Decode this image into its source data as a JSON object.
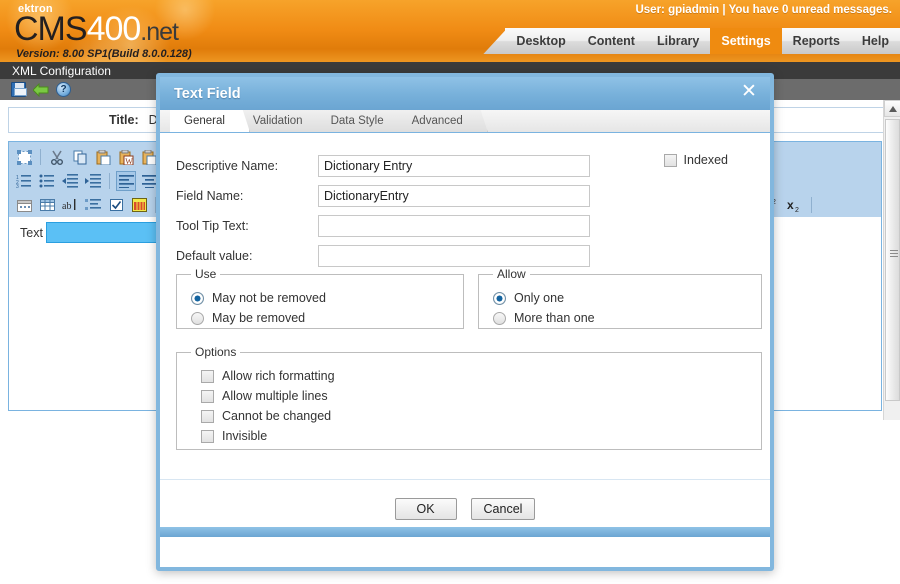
{
  "banner": {
    "brand_ektron": "ektron",
    "brand_cms": "CMS",
    "brand_400": "400",
    "brand_net": ".net",
    "version": "Version: 8.00 SP1(Build 8.0.0.128)",
    "user_info": "User: gpiadmin | You have 0 unread messages.",
    "accent_orange": "#ef8b10"
  },
  "nav": {
    "items": [
      {
        "label": "Desktop",
        "active": false
      },
      {
        "label": "Content",
        "active": false
      },
      {
        "label": "Library",
        "active": false
      },
      {
        "label": "Settings",
        "active": true
      },
      {
        "label": "Reports",
        "active": false
      },
      {
        "label": "Help",
        "active": false
      }
    ]
  },
  "page": {
    "title": "XML Configuration",
    "toolbar": [
      {
        "name": "save-icon",
        "tip": "Save"
      },
      {
        "name": "back-arrow-icon",
        "tip": "Back"
      },
      {
        "name": "help-icon",
        "tip": "Help"
      }
    ]
  },
  "title_row": {
    "label": "Title:",
    "value": "Dictionar"
  },
  "editor": {
    "row1": [
      "select-all-icon",
      "cut-icon",
      "copy-icon",
      "paste-icon",
      "paste-from-word-icon",
      "paste-plain-icon"
    ],
    "row2": [
      "numbered-list-icon",
      "bullet-list-icon",
      "outdent-icon",
      "indent-icon",
      "align-left-icon",
      "align-center-icon"
    ],
    "row3": [
      "insert-date-icon",
      "insert-table-icon",
      "spellcheck-icon",
      "definition-list-icon",
      "checkbox-field-icon",
      "calendar-field-icon"
    ],
    "right_tools": [
      "superscript-icon",
      "subscript-icon"
    ],
    "field_label": "Text"
  },
  "dialog": {
    "title": "Text Field",
    "close_label": "✕",
    "tabs": [
      {
        "label": "General",
        "active": true
      },
      {
        "label": "Validation",
        "active": false
      },
      {
        "label": "Data Style",
        "active": false
      },
      {
        "label": "Advanced",
        "active": false
      }
    ],
    "fields": [
      {
        "label": "Descriptive Name:",
        "value": "Dictionary Entry",
        "placeholder": ""
      },
      {
        "label": "Field Name:",
        "value": "DictionaryEntry",
        "placeholder": ""
      },
      {
        "label": "Tool Tip Text:",
        "value": "",
        "placeholder": ""
      },
      {
        "label": "Default value:",
        "value": "",
        "placeholder": ""
      }
    ],
    "indexed": {
      "label": "Indexed",
      "checked": false
    },
    "use": {
      "legend": "Use",
      "options": [
        {
          "label": "May not be removed",
          "checked": true
        },
        {
          "label": "May be removed",
          "checked": false
        }
      ]
    },
    "allow": {
      "legend": "Allow",
      "options": [
        {
          "label": "Only one",
          "checked": true
        },
        {
          "label": "More than one",
          "checked": false
        }
      ]
    },
    "options": {
      "legend": "Options",
      "items": [
        {
          "label": "Allow rich formatting",
          "checked": false
        },
        {
          "label": "Allow multiple lines",
          "checked": false
        },
        {
          "label": "Cannot be changed",
          "checked": false
        },
        {
          "label": "Invisible",
          "checked": false
        }
      ]
    },
    "buttons": {
      "ok": "OK",
      "cancel": "Cancel"
    }
  },
  "scrollbar": {
    "up_arrow": "▲"
  }
}
